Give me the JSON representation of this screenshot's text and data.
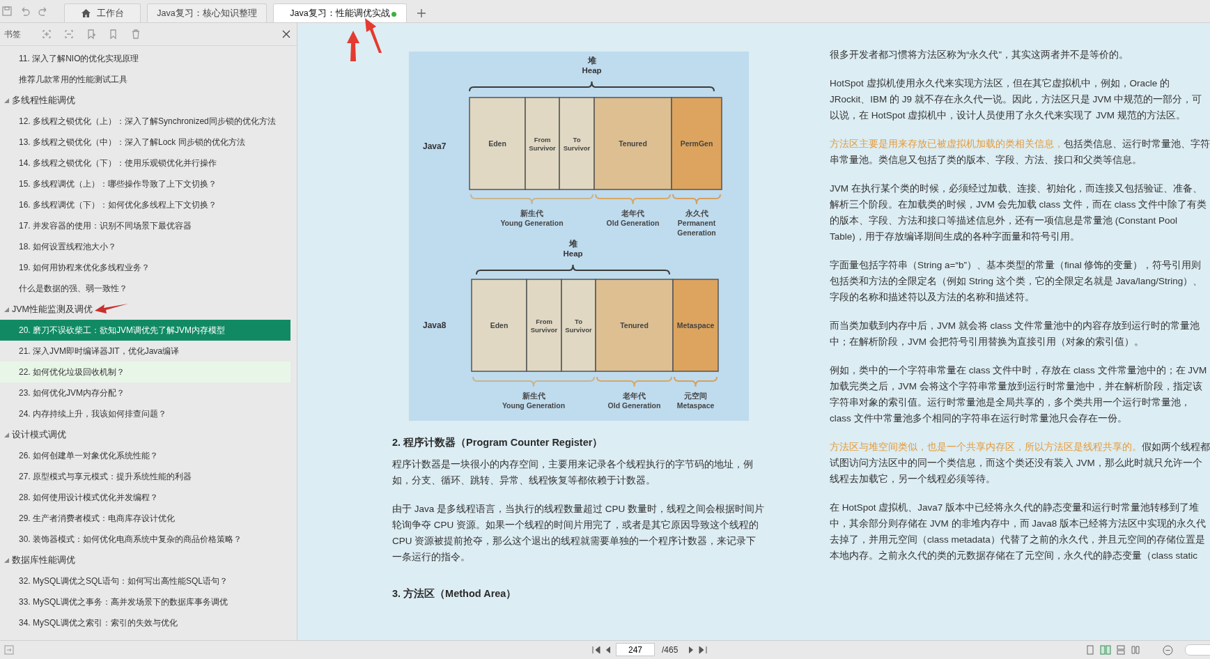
{
  "tabs": [
    {
      "kind": "home",
      "label": "工作台",
      "selected": false,
      "modified": false
    },
    {
      "kind": "doc",
      "label": "Java复习：核心知识整理",
      "selected": false,
      "modified": false
    },
    {
      "kind": "doc",
      "label": "Java复习：性能调优实战",
      "selected": true,
      "modified": true
    }
  ],
  "sidebar": {
    "title": "书签",
    "items": [
      {
        "label": "11. 深入了解NIO的优化实现原理",
        "selected": false,
        "hovered": false
      },
      {
        "label": "推荐几款常用的性能测试工具",
        "selected": false,
        "hovered": false
      },
      {
        "label": "多线程性能调优",
        "expanded": true,
        "children": [
          {
            "label": "12. 多线程之锁优化（上）：深入了解Synchronized同步锁的优化方法",
            "selected": false,
            "hovered": false
          },
          {
            "label": "13. 多线程之锁优化（中）：深入了解Lock 同步锁的优化方法",
            "selected": false,
            "hovered": false
          },
          {
            "label": "14. 多线程之锁优化（下）：使用乐观锁优化并行操作",
            "selected": false,
            "hovered": false
          },
          {
            "label": "15. 多线程调优（上）：哪些操作导致了上下文切换？",
            "selected": false,
            "hovered": false
          },
          {
            "label": "16. 多线程调优（下）：如何优化多线程上下文切换？",
            "selected": false,
            "hovered": false
          },
          {
            "label": "17. 并发容器的使用：识别不同场景下最优容器",
            "selected": false,
            "hovered": false
          },
          {
            "label": "18. 如何设置线程池大小？",
            "selected": false,
            "hovered": false
          },
          {
            "label": "19. 如何用协程来优化多线程业务？",
            "selected": false,
            "hovered": false
          },
          {
            "label": "什么是数据的强、弱一致性？",
            "selected": false,
            "hovered": false
          }
        ]
      },
      {
        "label": "JVM性能监测及调优",
        "expanded": true,
        "children": [
          {
            "label": "20. 磨刀不误砍柴工：欲知JVM调优先了解JVM内存模型",
            "selected": true,
            "hovered": false
          },
          {
            "label": "21. 深入JVM即时编译器JIT，优化Java编译",
            "selected": false,
            "hovered": false
          },
          {
            "label": "22. 如何优化垃圾回收机制？",
            "selected": false,
            "hovered": true
          },
          {
            "label": "23. 如何优化JVM内存分配？",
            "selected": false,
            "hovered": false
          },
          {
            "label": "24. 内存持续上升，我该如何排查问题？",
            "selected": false,
            "hovered": false
          }
        ]
      },
      {
        "label": "设计模式调优",
        "expanded": true,
        "children": [
          {
            "label": "26. 如何创建单一对象优化系统性能？",
            "selected": false,
            "hovered": false
          },
          {
            "label": "27. 原型模式与享元模式：提升系统性能的利器",
            "selected": false,
            "hovered": false
          },
          {
            "label": "28. 如何使用设计模式优化并发编程？",
            "selected": false,
            "hovered": false
          },
          {
            "label": "29. 生产者消费者模式：电商库存设计优化",
            "selected": false,
            "hovered": false
          },
          {
            "label": "30. 装饰器模式：如何优化电商系统中复杂的商品价格策略？",
            "selected": false,
            "hovered": false
          }
        ]
      },
      {
        "label": "数据库性能调优",
        "expanded": true,
        "children": [
          {
            "label": "32. MySQL调优之SQL语句：如何写出高性能SQL语句？",
            "selected": false,
            "hovered": false
          },
          {
            "label": "33. MySQL调优之事务：高并发场景下的数据库事务调优",
            "selected": false,
            "hovered": false
          },
          {
            "label": "34. MySQL调优之索引：索引的失效与优化",
            "selected": false,
            "hovered": false
          }
        ]
      }
    ]
  },
  "diagram": {
    "rows": [
      {
        "label": "Java7",
        "heap": [
          "堆",
          "Heap"
        ],
        "cells": [
          {
            "kind": "young",
            "lines": [
              "Eden"
            ]
          },
          {
            "kind": "young",
            "lines": [
              "From",
              "Survivor"
            ]
          },
          {
            "kind": "young",
            "lines": [
              "To",
              "Survivor"
            ]
          },
          {
            "kind": "old",
            "lines": [
              "Tenured"
            ]
          },
          {
            "kind": "meta",
            "lines": [
              "PermGen"
            ]
          }
        ],
        "groups": [
          {
            "kind": "young",
            "lines": [
              "新生代",
              "Young Generation"
            ]
          },
          {
            "kind": "old",
            "lines": [
              "老年代",
              "Old Generation"
            ]
          },
          {
            "kind": "meta",
            "lines": [
              "永久代",
              "Permanent",
              "Generation"
            ]
          }
        ]
      },
      {
        "label": "Java8",
        "heap": [
          "堆",
          "Heap"
        ],
        "cells": [
          {
            "kind": "young",
            "lines": [
              "Eden"
            ]
          },
          {
            "kind": "young",
            "lines": [
              "From",
              "Survivor"
            ]
          },
          {
            "kind": "young",
            "lines": [
              "To",
              "Survivor"
            ]
          },
          {
            "kind": "old",
            "lines": [
              "Tenured"
            ]
          },
          {
            "kind": "meta",
            "lines": [
              "Metaspace"
            ]
          }
        ],
        "groups": [
          {
            "kind": "young",
            "lines": [
              "新生代",
              "Young Generation"
            ]
          },
          {
            "kind": "old",
            "lines": [
              "老年代",
              "Old Generation"
            ]
          },
          {
            "kind": "meta",
            "lines": [
              "元空间",
              "Metaspace"
            ]
          }
        ]
      }
    ]
  },
  "middle": [
    {
      "kind": "heading",
      "segments": [
        {
          "text": "2. 程序计数器（Program Counter Register）",
          "highlight": false
        }
      ]
    },
    {
      "kind": "paragraph",
      "segments": [
        {
          "text": "程序计数器是一块很小的内存空间，主要用来记录各个线程执行的字节码的地址，例如，分支、循环、跳转、异常、线程恢复等都依赖于计数器。",
          "highlight": false
        }
      ]
    },
    {
      "kind": "paragraph",
      "segments": [
        {
          "text": "由于 Java 是多线程语言，当执行的线程数量超过 CPU 数量时，线程之间会根据时间片轮询争夺 CPU 资源。如果一个线程的时间片用完了，或者是其它原因导致这个线程的 CPU 资源被提前抢夺，那么这个退出的线程就需要单独的一个程序计数器，来记录下一条运行的指令。",
          "highlight": false
        }
      ]
    },
    {
      "kind": "heading",
      "segments": [
        {
          "text": "3. 方法区（Method Area）",
          "highlight": false
        }
      ]
    }
  ],
  "right": [
    {
      "kind": "paragraph",
      "segments": [
        {
          "text": "很多开发者都习惯将方法区称为“永久代”，其实这两者并不是等价的。",
          "highlight": false
        }
      ]
    },
    {
      "kind": "paragraph",
      "segments": [
        {
          "text": "HotSpot 虚拟机使用永久代来实现方法区，但在其它虚拟机中，例如，Oracle 的 JRockit、IBM 的 J9 就不存在永久代一说。因此，方法区只是 JVM 中规范的一部分，可以说，在 HotSpot 虚拟机中，设计人员使用了永久代来实现了 JVM 规范的方法区。",
          "highlight": false
        }
      ]
    },
    {
      "kind": "paragraph",
      "segments": [
        {
          "text": "方法区主要是用来存放已被虚拟机加载的类相关信息，",
          "highlight": true
        },
        {
          "text": "包括类信息、运行时常量池、字符串常量池。类信息又包括了类的版本、字段、方法、接口和父类等信息。",
          "highlight": false
        }
      ]
    },
    {
      "kind": "paragraph",
      "segments": [
        {
          "text": "JVM 在执行某个类的时候，必须经过加载、连接、初始化，而连接又包括验证、准备、解析三个阶段。在加载类的时候，JVM 会先加载 class 文件，而在 class 文件中除了有类的版本、字段、方法和接口等描述信息外，还有一项信息是常量池 (Constant Pool Table)，用于存放编译期间生成的各种字面量和符号引用。",
          "highlight": false
        }
      ]
    },
    {
      "kind": "paragraph",
      "segments": [
        {
          "text": "字面量包括字符串（String a=“b”）、基本类型的常量（final 修饰的变量），符号引用则包括类和方法的全限定名（例如 String 这个类，它的全限定名就是 Java/lang/String）、字段的名称和描述符以及方法的名称和描述符。",
          "highlight": false
        }
      ]
    },
    {
      "kind": "paragraph",
      "segments": [
        {
          "text": "而当类加载到内存中后，JVM 就会将 class 文件常量池中的内容存放到运行时的常量池中；在解析阶段，JVM 会把符号引用替换为直接引用（对象的索引值）。",
          "highlight": false
        }
      ]
    },
    {
      "kind": "paragraph",
      "segments": [
        {
          "text": "例如，类中的一个字符串常量在 class 文件中时，存放在 class 文件常量池中的；在 JVM 加载完类之后，JVM 会将这个字符串常量放到运行时常量池中，并在解析阶段，指定该字符串对象的索引值。运行时常量池是全局共享的，多个类共用一个运行时常量池，class 文件中常量池多个相同的字符串在运行时常量池只会存在一份。",
          "highlight": false
        }
      ]
    },
    {
      "kind": "paragraph",
      "segments": [
        {
          "text": "方法区与堆空间类似，也是一个共享内存区，所以方法区是线程共享的。",
          "highlight": true
        },
        {
          "text": "假如两个线程都试图访问方法区中的同一个类信息，而这个类还没有装入 JVM，那么此时就只允许一个线程去加载它，另一个线程必须等待。",
          "highlight": false
        }
      ]
    },
    {
      "kind": "paragraph",
      "segments": [
        {
          "text": "在 HotSpot 虚拟机、Java7 版本中已经将永久代的静态变量和运行时常量池转移到了堆中，其余部分则存储在 JVM 的非堆内存中，而 Java8 版本已经将方法区中实现的永久代去掉了，并用元空间（class metadata）代替了之前的永久代，并且元空间的存储位置是本地内存。之前永久代的类的元数据存储在了元空间，永久代的静态变量（class static",
          "highlight": false
        }
      ]
    }
  ],
  "pager": {
    "page": "247",
    "total": "/465"
  }
}
